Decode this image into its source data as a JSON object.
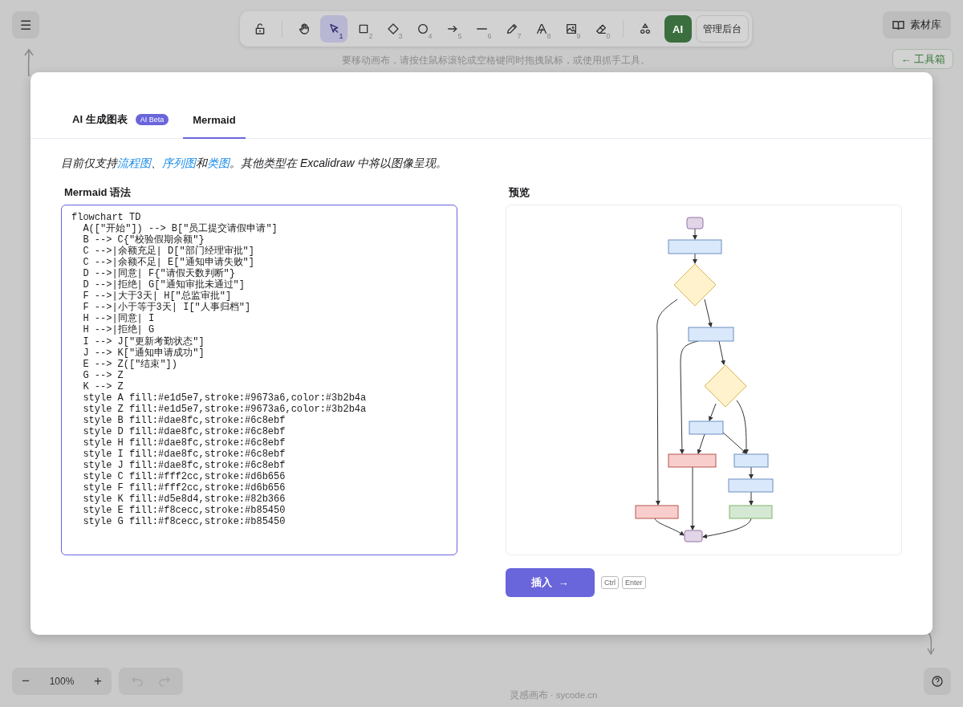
{
  "menu_button": {
    "label": "☰"
  },
  "toolbar": {
    "tools": [
      {
        "selected": false
      },
      {
        "selected": false
      },
      {
        "key": "1",
        "selected": true
      },
      {
        "key": "2",
        "selected": false
      },
      {
        "key": "3",
        "selected": false
      },
      {
        "key": "4",
        "selected": false
      },
      {
        "key": "5",
        "selected": false
      },
      {
        "key": "6",
        "selected": false
      },
      {
        "key": "7",
        "selected": false
      },
      {
        "key": "8",
        "selected": false
      },
      {
        "key": "9",
        "selected": false
      },
      {
        "key": "0",
        "selected": false
      }
    ],
    "ai_button": "AI",
    "admin_button": "管理后台"
  },
  "canvas_hint": "要移动画布，请按住鼠标滚轮或空格键同时拖拽鼠标，或使用抓手工具。",
  "library_button": "素材库",
  "toolbox_button": "← 工具箱",
  "dialog": {
    "tabs": [
      {
        "label": "AI 生成图表",
        "badge": "AI Beta",
        "selected": false
      },
      {
        "label": "Mermaid",
        "selected": true
      }
    ],
    "notice": [
      {
        "text": "目前仅支持",
        "link": false
      },
      {
        "text": "流程图",
        "link": true
      },
      {
        "text": "、",
        "link": false
      },
      {
        "text": "序列图",
        "link": true
      },
      {
        "text": "和",
        "link": false
      },
      {
        "text": "类图",
        "link": true
      },
      {
        "text": "。其他类型在 Excalidraw 中将以图像呈现。",
        "link": false
      }
    ],
    "editor": {
      "label": "Mermaid 语法",
      "lines": [
        "flowchart TD",
        "  A([\"开始\"]) --> B[\"员工提交请假申请\"]",
        "  B --> C{\"校验假期余额\"}",
        "  C -->|余额充足| D[\"部门经理审批\"]",
        "  C -->|余额不足| E[\"通知申请失败\"]",
        "  D -->|同意| F{\"请假天数判断\"}",
        "  D -->|拒绝| G[\"通知审批未通过\"]",
        "  F -->|大于3天| H[\"总监审批\"]",
        "  F -->|小于等于3天| I[\"人事归档\"]",
        "  H -->|同意| I",
        "  H -->|拒绝| G",
        "  I --> J[\"更新考勤状态\"]",
        "  J --> K[\"通知申请成功\"]",
        "  E --> Z([\"结束\"])",
        "  G --> Z",
        "  K --> Z",
        "  style A fill:#e1d5e7,stroke:#9673a6,color:#3b2b4a",
        "  style Z fill:#e1d5e7,stroke:#9673a6,color:#3b2b4a",
        "  style B fill:#dae8fc,stroke:#6c8ebf",
        "  style D fill:#dae8fc,stroke:#6c8ebf",
        "  style H fill:#dae8fc,stroke:#6c8ebf",
        "  style I fill:#dae8fc,stroke:#6c8ebf",
        "  style J fill:#dae8fc,stroke:#6c8ebf",
        "  style C fill:#fff2cc,stroke:#d6b656",
        "  style F fill:#fff2cc,stroke:#d6b656",
        "  style K fill:#d5e8d4,stroke:#82b366",
        "  style E fill:#f8cecc,stroke:#b85450",
        "  style G fill:#f8cecc,stroke:#b85450"
      ]
    },
    "preview": {
      "label": "预览"
    },
    "insert_button": "插入  →",
    "shortcut_keys": [
      "Ctrl",
      "Enter"
    ]
  },
  "zoom": {
    "out": "−",
    "level": "100%",
    "in": "+"
  },
  "footer": "灵感画布 · sycode.cn"
}
